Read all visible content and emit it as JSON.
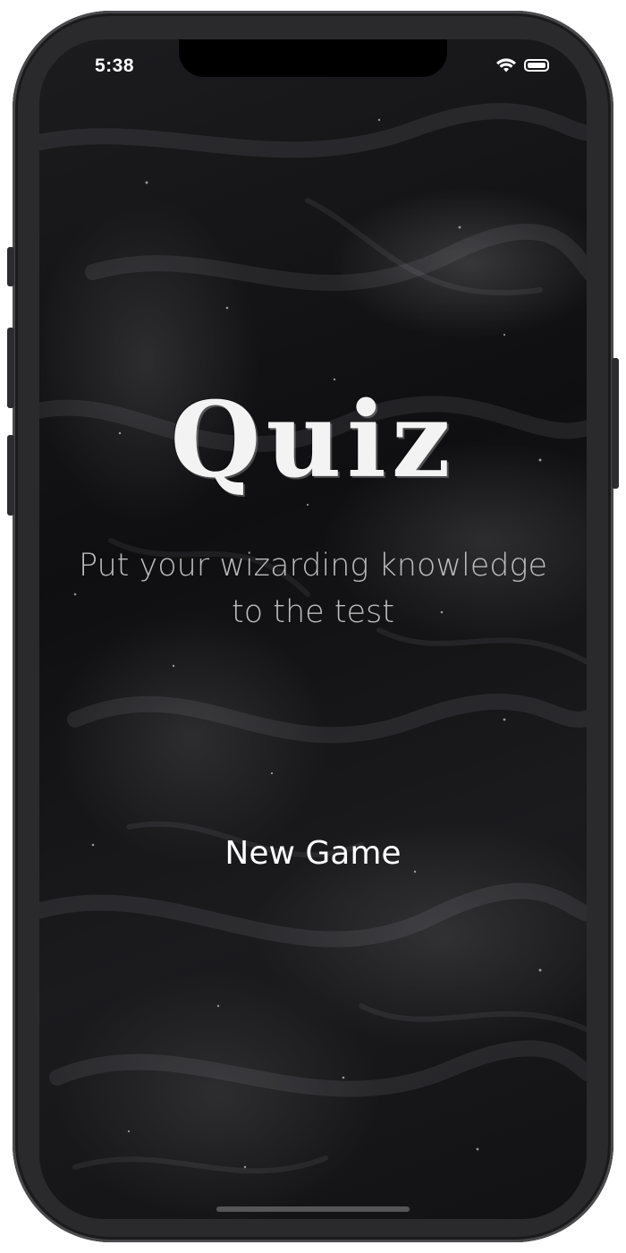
{
  "status_bar": {
    "time": "5:38",
    "wifi_icon": "wifi-icon",
    "battery_icon": "battery-icon",
    "battery_level": 1.0
  },
  "main": {
    "logo_text": "Quiz",
    "tagline": "Put your wizarding knowledge to the test",
    "new_game_label": "New Game"
  },
  "colors": {
    "background": "#141416",
    "text": "#ffffff",
    "tagline": "#bdbdbd"
  }
}
